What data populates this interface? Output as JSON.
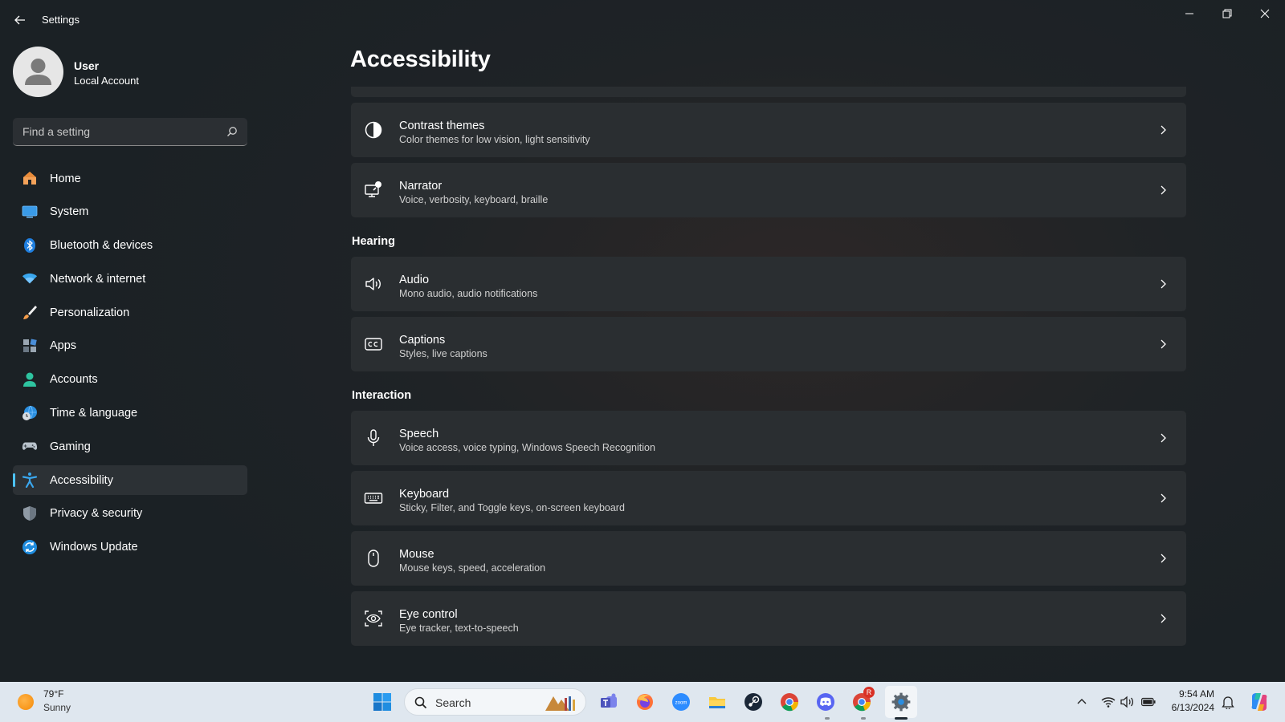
{
  "window": {
    "title": "Settings"
  },
  "profile": {
    "name": "User",
    "account_type": "Local Account"
  },
  "search": {
    "placeholder": "Find a setting"
  },
  "sidebar": {
    "items": [
      {
        "label": "Home",
        "icon": "home-icon"
      },
      {
        "label": "System",
        "icon": "system-icon"
      },
      {
        "label": "Bluetooth & devices",
        "icon": "bluetooth-icon"
      },
      {
        "label": "Network & internet",
        "icon": "wifi-icon"
      },
      {
        "label": "Personalization",
        "icon": "brush-icon"
      },
      {
        "label": "Apps",
        "icon": "apps-icon"
      },
      {
        "label": "Accounts",
        "icon": "accounts-icon"
      },
      {
        "label": "Time & language",
        "icon": "globe-clock-icon"
      },
      {
        "label": "Gaming",
        "icon": "gamepad-icon"
      },
      {
        "label": "Accessibility",
        "icon": "accessibility-icon",
        "active": true
      },
      {
        "label": "Privacy & security",
        "icon": "shield-icon"
      },
      {
        "label": "Windows Update",
        "icon": "update-icon"
      }
    ]
  },
  "main": {
    "title": "Accessibility",
    "vision_items": [
      {
        "title": "Contrast themes",
        "subtitle": "Color themes for low vision, light sensitivity",
        "icon": "contrast-icon"
      },
      {
        "title": "Narrator",
        "subtitle": "Voice, verbosity, keyboard, braille",
        "icon": "narrator-icon"
      }
    ],
    "hearing": {
      "heading": "Hearing",
      "items": [
        {
          "title": "Audio",
          "subtitle": "Mono audio, audio notifications",
          "icon": "speaker-icon"
        },
        {
          "title": "Captions",
          "subtitle": "Styles, live captions",
          "icon": "captions-icon"
        }
      ]
    },
    "interaction": {
      "heading": "Interaction",
      "items": [
        {
          "title": "Speech",
          "subtitle": "Voice access, voice typing, Windows Speech Recognition",
          "icon": "microphone-icon"
        },
        {
          "title": "Keyboard",
          "subtitle": "Sticky, Filter, and Toggle keys, on-screen keyboard",
          "icon": "keyboard-icon"
        },
        {
          "title": "Mouse",
          "subtitle": "Mouse keys, speed, acceleration",
          "icon": "mouse-icon"
        },
        {
          "title": "Eye control",
          "subtitle": "Eye tracker, text-to-speech",
          "icon": "eye-control-icon"
        }
      ]
    }
  },
  "taskbar": {
    "weather": {
      "temp": "79°F",
      "condition": "Sunny"
    },
    "search_label": "Search",
    "time": "9:54 AM",
    "date": "6/13/2024",
    "chrome_badge": "R"
  },
  "colors": {
    "accent": "#4cc2ff",
    "card_bg": "#2a2e31",
    "window_bg": "#1f2326",
    "taskbar_bg": "#dfe7ef"
  }
}
